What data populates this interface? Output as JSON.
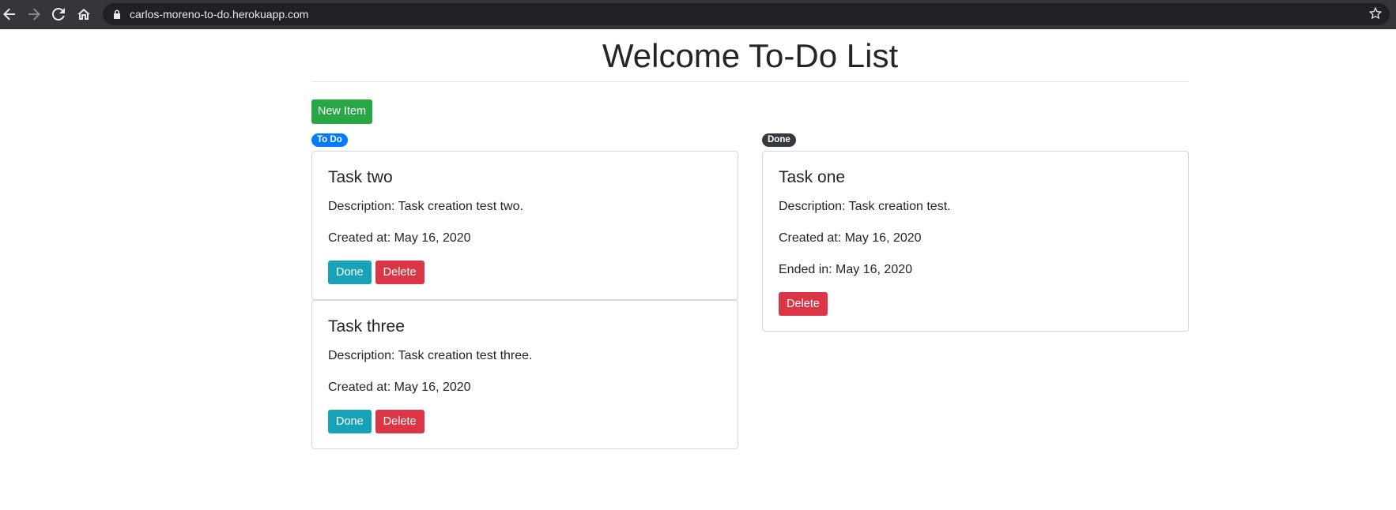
{
  "browser": {
    "url": "carlos-moreno-to-do.herokuapp.com",
    "back_icon": "arrow-left-icon",
    "forward_icon": "arrow-right-icon",
    "reload_icon": "reload-icon",
    "home_icon": "home-icon",
    "lock_icon": "lock-icon",
    "bookmark_icon": "star-icon"
  },
  "page": {
    "title": "Welcome To-Do List",
    "new_item_label": "New Item"
  },
  "colors": {
    "success": "#28a745",
    "info": "#17a2b8",
    "danger": "#dc3545",
    "primary": "#007bff",
    "dark": "#343a40"
  },
  "todo": {
    "badge": "To Do",
    "tasks": [
      {
        "title": "Task two",
        "description": "Description: Task creation test two.",
        "created": "Created at: May 16, 2020",
        "done_label": "Done",
        "delete_label": "Delete"
      },
      {
        "title": "Task three",
        "description": "Description: Task creation test three.",
        "created": "Created at: May 16, 2020",
        "done_label": "Done",
        "delete_label": "Delete"
      }
    ]
  },
  "done": {
    "badge": "Done",
    "tasks": [
      {
        "title": "Task one",
        "description": "Description: Task creation test.",
        "created": "Created at: May 16, 2020",
        "ended": "Ended in: May 16, 2020",
        "delete_label": "Delete"
      }
    ]
  }
}
